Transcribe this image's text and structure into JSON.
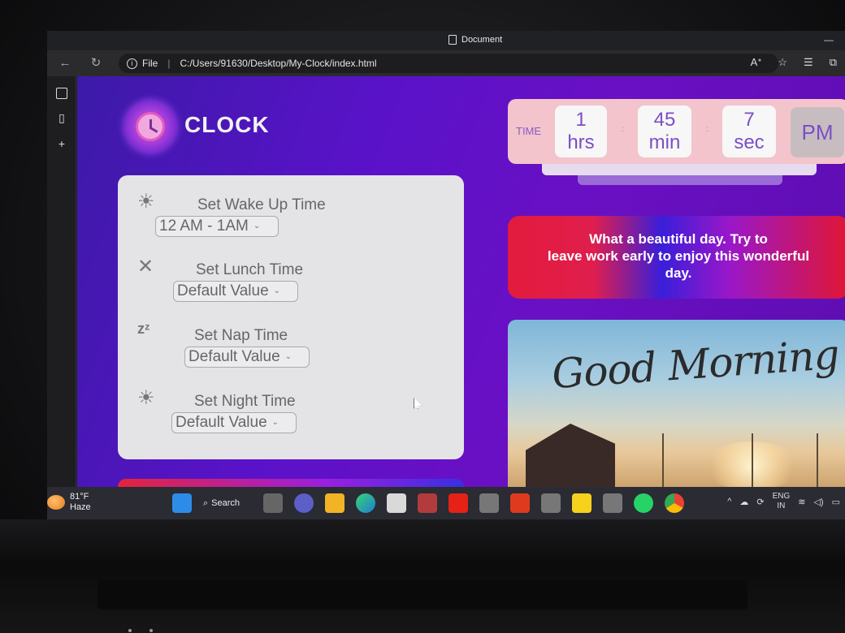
{
  "browser": {
    "tab_title": "Document",
    "url_prefix": "File",
    "url": "C:/Users/91630/Desktop/My-Clock/index.html"
  },
  "app": {
    "brand": "CLOCK"
  },
  "alarms": [
    {
      "label": "Set Wake Up Time",
      "value": "12 AM - 1AM",
      "icon": "sun-icon"
    },
    {
      "label": "Set Lunch Time",
      "value": "Default Value",
      "icon": "fork-knife-icon"
    },
    {
      "label": "Set Nap Time",
      "value": "Default Value",
      "icon": "zzz-icon"
    },
    {
      "label": "Set Night Time",
      "value": "Default Value",
      "icon": "sun-icon"
    }
  ],
  "clock": {
    "label": "TIME",
    "hours": "1",
    "hours_unit": "hrs",
    "minutes": "45",
    "minutes_unit": "min",
    "seconds": "7",
    "seconds_unit": "sec",
    "ampm": "PM",
    "colon": ":"
  },
  "message": {
    "line1": "What a beautiful day. Try to",
    "line2": "leave work early to enjoy this wonderful",
    "line3": "day."
  },
  "image": {
    "caption": "Good Morning"
  },
  "taskbar": {
    "temperature": "81°F",
    "condition": "Haze",
    "search_label": "Search",
    "lang_line1": "ENG",
    "lang_line2": "IN"
  }
}
